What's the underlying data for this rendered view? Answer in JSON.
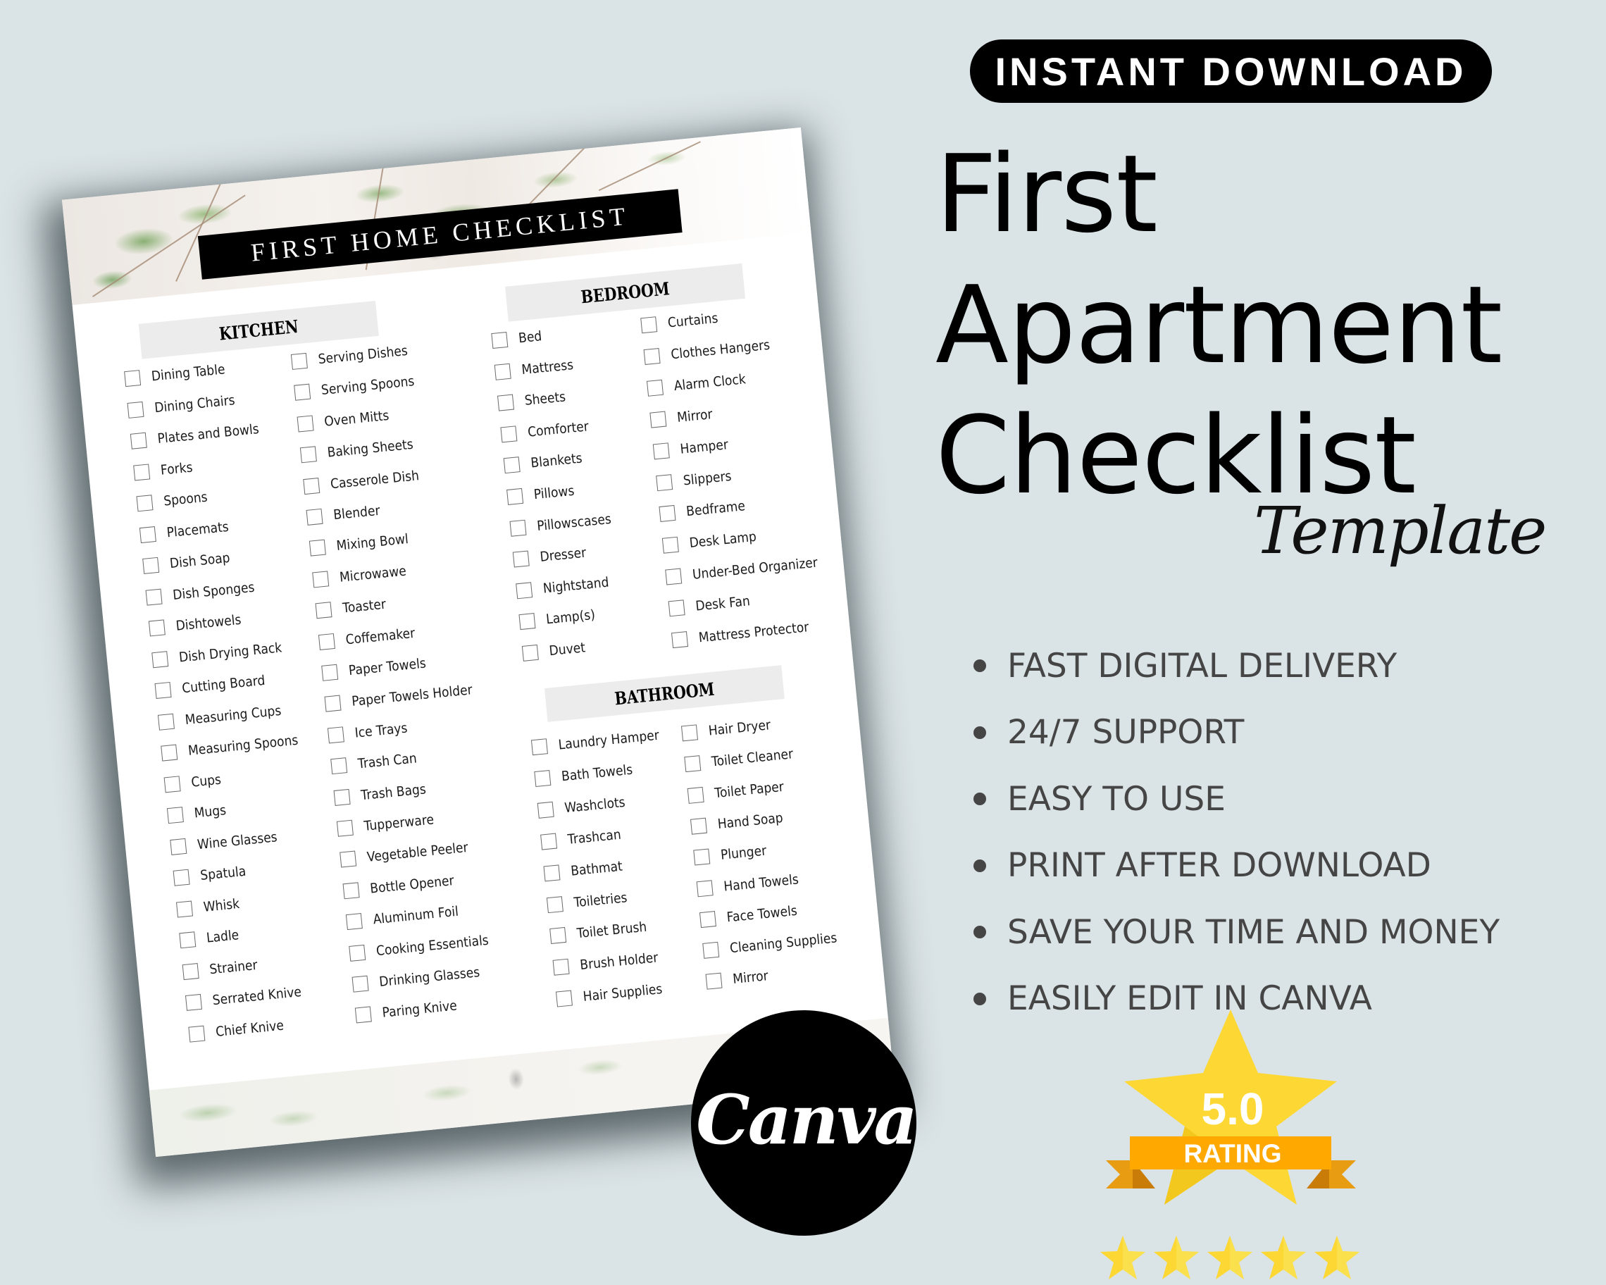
{
  "badge": {
    "label": "INSTANT DOWNLOAD"
  },
  "headline": {
    "line1": "First",
    "line2": "Apartment",
    "line3": "Checklist",
    "script": "Template"
  },
  "features": [
    "FAST DIGITAL DELIVERY",
    "24/7 SUPPORT",
    "EASY TO USE",
    "PRINT AFTER DOWNLOAD",
    "SAVE YOUR TIME AND MONEY",
    "EASILY EDIT IN CANVA"
  ],
  "rating": {
    "score": "5.0",
    "label": "RATING",
    "stars": 5,
    "star_color": "#fdd835",
    "ribbon_color": "#ffa800"
  },
  "canva_logo": {
    "text": "Canva"
  },
  "checklist": {
    "title": "FIRST HOME CHECKLIST",
    "sections": [
      {
        "name": "KITCHEN",
        "columns": [
          [
            "Dining Table",
            "Dining Chairs",
            "Plates and Bowls",
            "Forks",
            "Spoons",
            "Placemats",
            "Dish Soap",
            "Dish Sponges",
            "Dishtowels",
            "Dish Drying Rack",
            "Cutting Board",
            "Measuring Cups",
            "Measuring Spoons",
            "Cups",
            "Mugs",
            "Wine Glasses",
            "Spatula",
            "Whisk",
            "Ladle",
            "Strainer",
            "Serrated Knive",
            "Chief Knive"
          ],
          [
            "Serving Dishes",
            "Serving Spoons",
            "Oven Mitts",
            "Baking Sheets",
            "Casserole Dish",
            "Blender",
            "Mixing Bowl",
            "Microwawe",
            "Toaster",
            "Coffemaker",
            "Paper Towels",
            "Paper Towels Holder",
            "Ice Trays",
            "Trash Can",
            "Trash Bags",
            "Tupperware",
            "Vegetable Peeler",
            "Bottle Opener",
            "Aluminum Foil",
            "Cooking Essentials",
            "Drinking Glasses",
            "Paring Knive"
          ]
        ]
      },
      {
        "name": "BEDROOM",
        "columns": [
          [
            "Bed",
            "Mattress",
            "Sheets",
            "Comforter",
            "Blankets",
            "Pillows",
            "Pillowscases",
            "Dresser",
            "Nightstand",
            "Lamp(s)",
            "Duvet"
          ],
          [
            "Curtains",
            "Clothes Hangers",
            "Alarm Clock",
            "Mirror",
            "Hamper",
            "Slippers",
            "Bedframe",
            "Desk Lamp",
            "Under-Bed Organizer",
            "Desk Fan",
            "Mattress Protector"
          ]
        ]
      },
      {
        "name": "BATHROOM",
        "columns": [
          [
            "Laundry Hamper",
            "Bath Towels",
            "Washclots",
            "Trashcan",
            "Bathmat",
            "Toiletries",
            "Toilet Brush",
            "Brush Holder",
            "Hair Supplies"
          ],
          [
            "Hair Dryer",
            "Toilet Cleaner",
            "Toilet Paper",
            "Hand Soap",
            "Plunger",
            "Hand Towels",
            "Face Towels",
            "Cleaning Supplies",
            "Mirror"
          ]
        ]
      }
    ]
  }
}
